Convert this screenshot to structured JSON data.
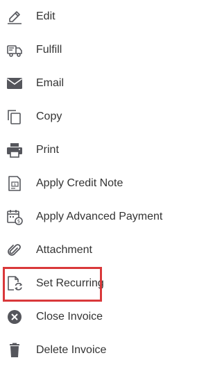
{
  "menu": {
    "items": [
      {
        "label": "Edit",
        "icon": "pencil-icon"
      },
      {
        "label": "Fulfill",
        "icon": "truck-icon"
      },
      {
        "label": "Email",
        "icon": "envelope-icon"
      },
      {
        "label": "Copy",
        "icon": "copy-icon"
      },
      {
        "label": "Print",
        "icon": "printer-icon"
      },
      {
        "label": "Apply Credit Note",
        "icon": "credit-note-icon"
      },
      {
        "label": "Apply Advanced Payment",
        "icon": "calendar-payment-icon"
      },
      {
        "label": "Attachment",
        "icon": "paperclip-icon"
      },
      {
        "label": "Set Recurring",
        "icon": "recurring-document-icon"
      },
      {
        "label": "Close Invoice",
        "icon": "close-circle-icon"
      },
      {
        "label": "Delete Invoice",
        "icon": "trash-icon"
      }
    ],
    "highlighted_item": "Set Recurring",
    "colors": {
      "icon": "#55565c",
      "text": "#333333",
      "highlight_border": "#d9383a"
    }
  }
}
